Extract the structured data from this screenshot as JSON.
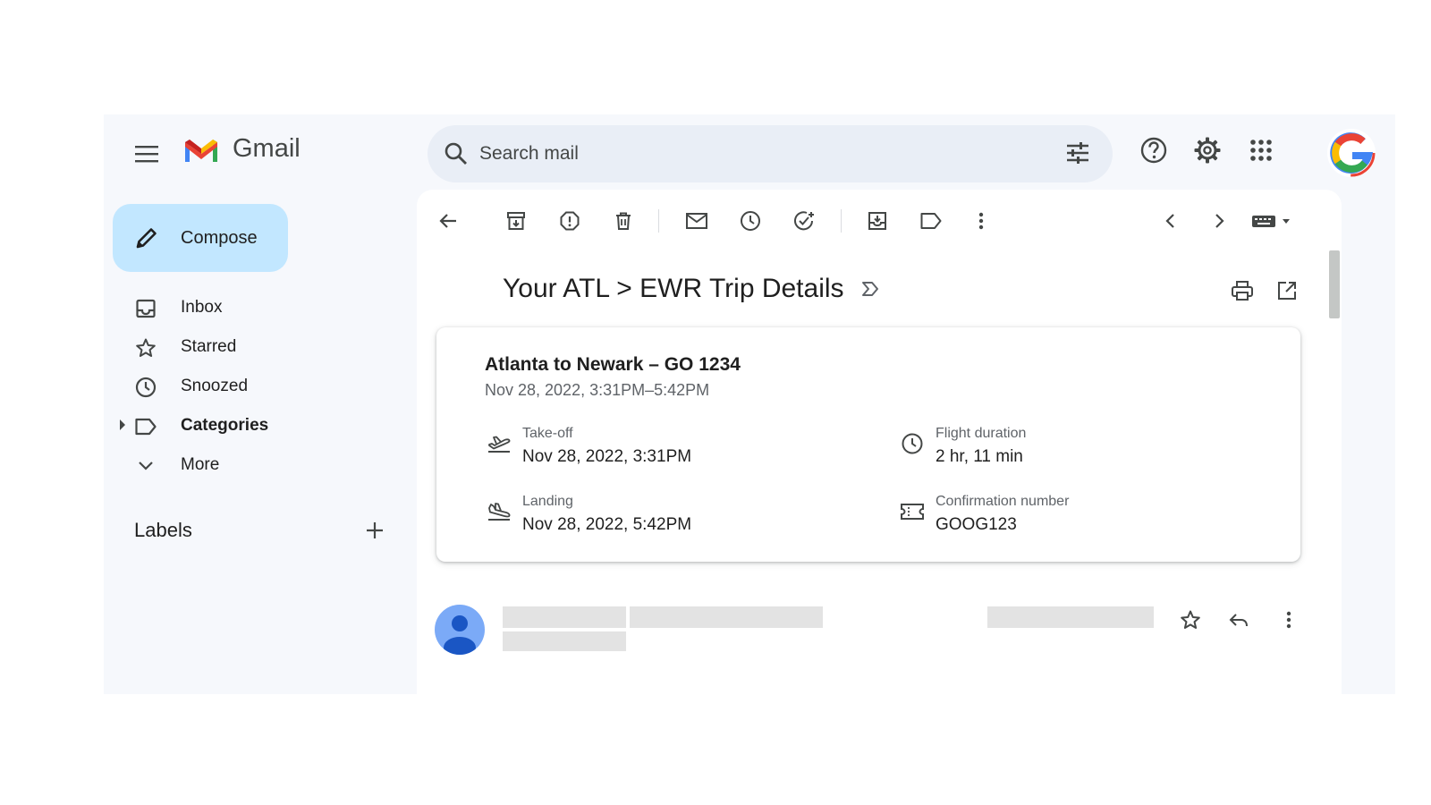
{
  "app": {
    "name": "Gmail"
  },
  "search": {
    "placeholder": "Search mail"
  },
  "sidebar": {
    "compose_label": "Compose",
    "items": [
      {
        "label": "Inbox",
        "icon": "inbox-icon"
      },
      {
        "label": "Starred",
        "icon": "star-icon"
      },
      {
        "label": "Snoozed",
        "icon": "clock-icon"
      },
      {
        "label": "Categories",
        "icon": "label-icon"
      },
      {
        "label": "More",
        "icon": "chevron-down-icon"
      }
    ],
    "labels_heading": "Labels"
  },
  "email": {
    "subject": "Your ATL > EWR Trip Details",
    "card": {
      "title": "Atlanta to Newark – GO 1234",
      "subtitle": "Nov 28, 2022, 3:31PM–5:42PM",
      "takeoff_label": "Take-off",
      "takeoff_value": "Nov 28, 2022, 3:31PM",
      "landing_label": "Landing",
      "landing_value": "Nov 28, 2022, 5:42PM",
      "duration_label": "Flight duration",
      "duration_value": "2 hr, 11 min",
      "confirmation_label": "Confirmation number",
      "confirmation_value": "GOOG123"
    }
  },
  "colors": {
    "app_bg": "#f6f8fc",
    "compose_bg": "#c2e7ff",
    "search_bg": "#e9eef6",
    "gmail_red": "#ea4335",
    "gmail_blue": "#4285f4",
    "gmail_green": "#34a853",
    "gmail_yellow": "#fbbc04"
  }
}
